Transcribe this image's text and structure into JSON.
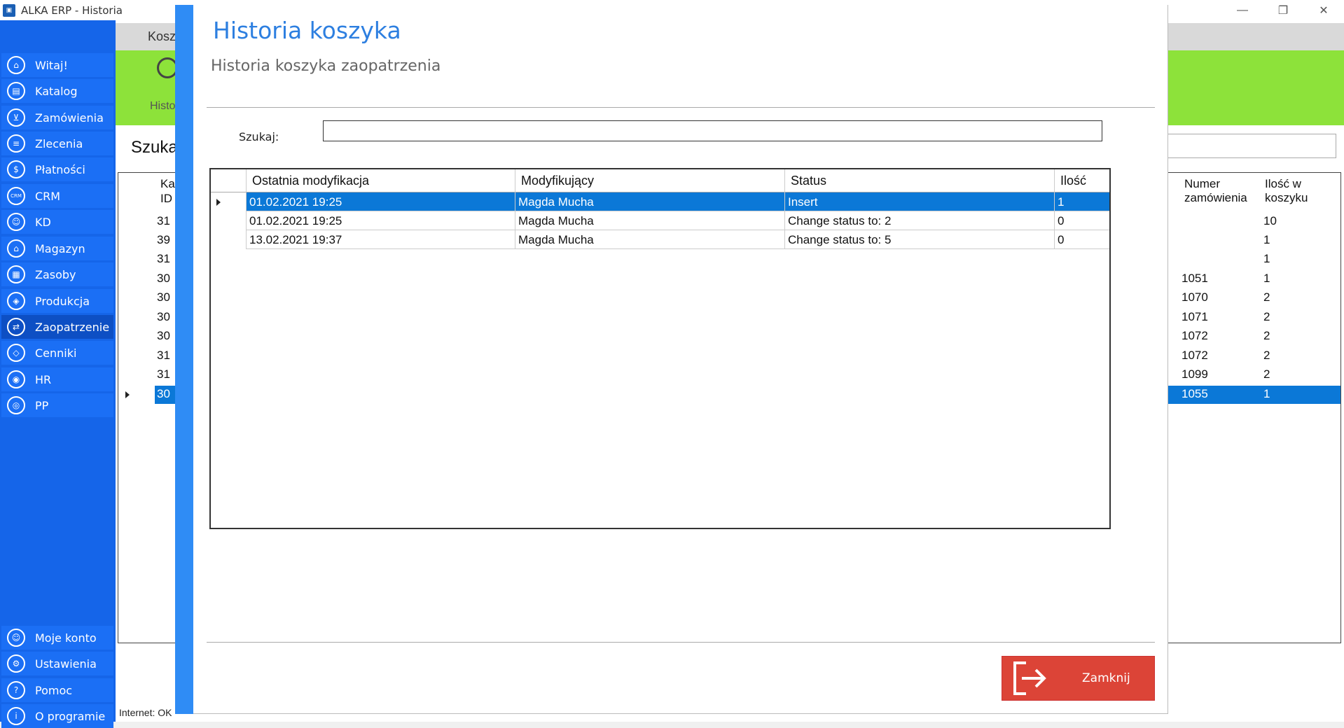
{
  "window": {
    "title": "ALKA ERP - Historia",
    "controls": [
      "—",
      "❐",
      "✕"
    ]
  },
  "sidebar": {
    "items": [
      {
        "label": "Witaj!",
        "icon": "home-icon"
      },
      {
        "label": "Katalog",
        "icon": "book-icon"
      },
      {
        "label": "Zamówienia",
        "icon": "cart-icon"
      },
      {
        "label": "Zlecenia",
        "icon": "list-icon"
      },
      {
        "label": "Płatności",
        "icon": "dollar-icon"
      },
      {
        "label": "CRM",
        "icon": "crm-icon"
      },
      {
        "label": "KD",
        "icon": "person-icon"
      },
      {
        "label": "Magazyn",
        "icon": "warehouse-icon"
      },
      {
        "label": "Zasoby",
        "icon": "box-icon"
      },
      {
        "label": "Produkcja",
        "icon": "production-icon"
      },
      {
        "label": "Zaopatrzenie",
        "icon": "truck-icon"
      },
      {
        "label": "Cenniki",
        "icon": "tag-icon"
      },
      {
        "label": "HR",
        "icon": "hr-icon"
      },
      {
        "label": "PP",
        "icon": "pp-icon"
      }
    ],
    "bottom_items": [
      {
        "label": "Moje konto",
        "icon": "user-icon"
      },
      {
        "label": "Ustawienia",
        "icon": "gear-icon"
      },
      {
        "label": "Pomoc",
        "icon": "help-icon"
      },
      {
        "label": "O programie",
        "icon": "info-icon"
      }
    ]
  },
  "background": {
    "tab_label": "Kosz",
    "ribbon_label": "Histo",
    "search_title": "Szuka",
    "grid_header_left": [
      "Ka",
      "ID"
    ],
    "grid_header_right": [
      "Numer zamówienia",
      "Ilość w koszyku"
    ],
    "rows": [
      {
        "id": "31",
        "numer": "",
        "ilosc": "10"
      },
      {
        "id": "39",
        "numer": "",
        "ilosc": "1"
      },
      {
        "id": "31",
        "numer": "",
        "ilosc": "1"
      },
      {
        "id": "30",
        "numer": "1051",
        "ilosc": "1"
      },
      {
        "id": "30",
        "numer": "1070",
        "ilosc": "2"
      },
      {
        "id": "30",
        "numer": "1071",
        "ilosc": "2"
      },
      {
        "id": "30",
        "numer": "1072",
        "ilosc": "2"
      },
      {
        "id": "31",
        "numer": "1072",
        "ilosc": "2"
      },
      {
        "id": "31",
        "numer": "1099",
        "ilosc": "2"
      },
      {
        "id": "30",
        "numer": "1055",
        "ilosc": "1"
      }
    ],
    "selected_row": 9
  },
  "status_bar": {
    "internet": "Internet: OK"
  },
  "modal": {
    "title": "Historia koszyka",
    "subtitle": "Historia koszyka zaopatrzenia",
    "search_label": "Szukaj:",
    "search_value": "",
    "columns": [
      "Ostatnia modyfikacja",
      "Modyfikujący",
      "Status",
      "Ilość"
    ],
    "rows": [
      {
        "date": "01.02.2021 19:25",
        "user": "Magda Mucha",
        "status": "Insert",
        "qty": "1"
      },
      {
        "date": "01.02.2021 19:25",
        "user": "Magda Mucha",
        "status": "Change status to: 2",
        "qty": "0"
      },
      {
        "date": "13.02.2021 19:37",
        "user": "Magda Mucha",
        "status": "Change status to: 5",
        "qty": "0"
      }
    ],
    "selected_row": 0,
    "close_label": "Zamknij"
  },
  "colors": {
    "sidebar": "#1565e9",
    "ribbon": "#8de23a",
    "modal_title": "#2d7fe0",
    "selection": "#0b78d7",
    "close_button": "#dc4437"
  }
}
